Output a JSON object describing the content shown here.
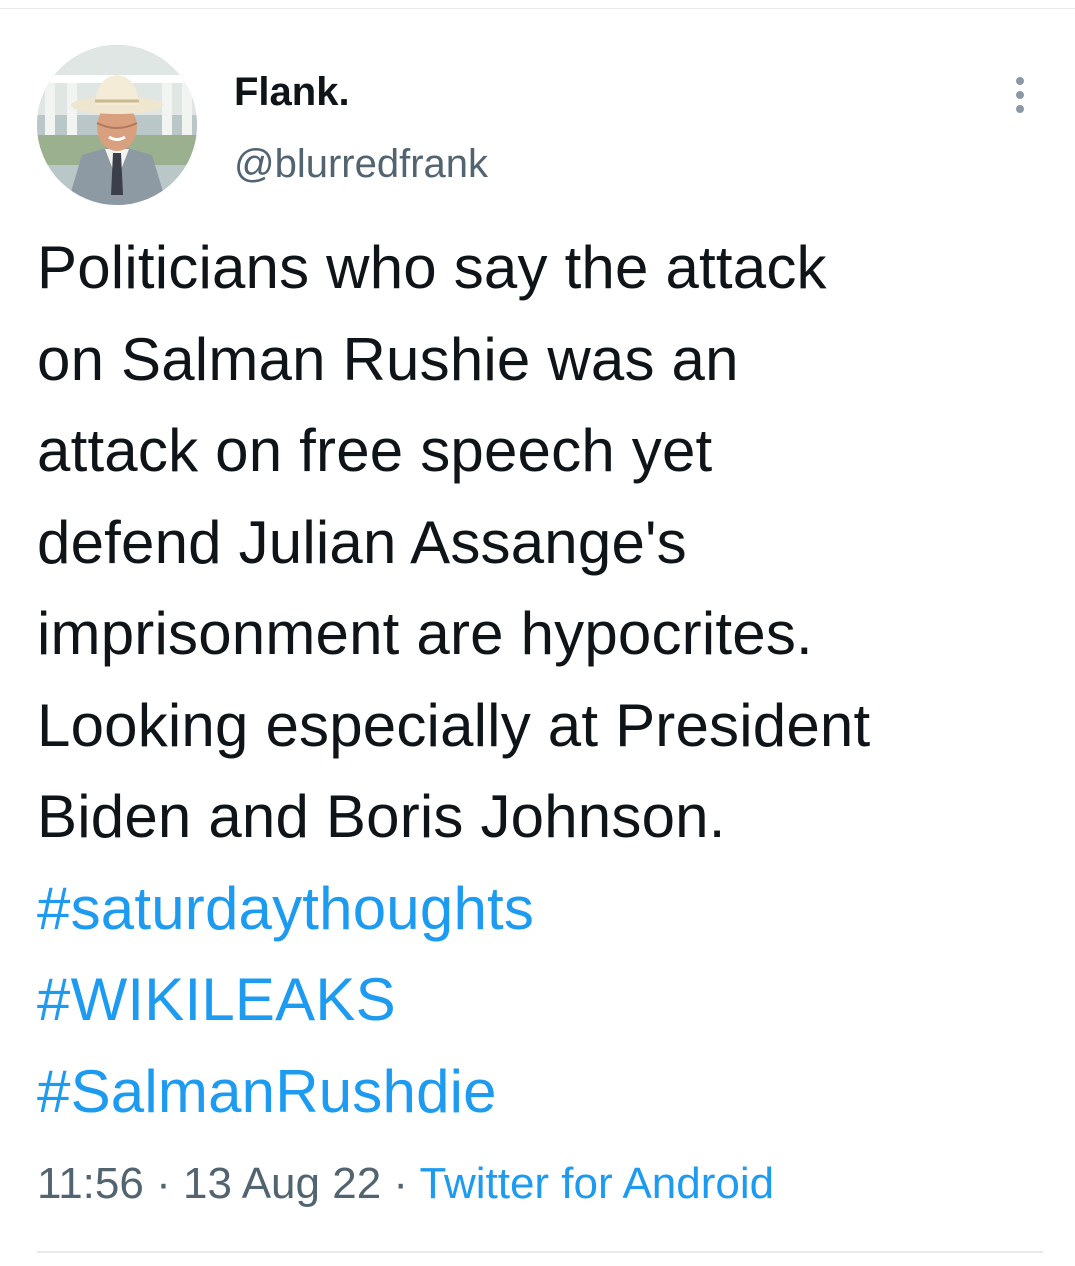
{
  "author": {
    "display_name": "Flank.",
    "handle": "@blurredfrank"
  },
  "tweet": {
    "text_lines": [
      "Politicians who say the attack",
      "on Salman Rushie was an",
      "attack on free speech yet",
      "defend Julian Assange's",
      "imprisonment are hypocrites.",
      "Looking especially at President",
      "Biden and Boris Johnson."
    ],
    "hashtags": [
      "#saturdaythoughts",
      "#WIKILEAKS",
      "#SalmanRushdie"
    ]
  },
  "meta": {
    "time": "11:56",
    "separator": "·",
    "date": "13 Aug 22",
    "source": "Twitter for Android"
  },
  "icons": {
    "more": "more-vertical-icon"
  },
  "colors": {
    "text": "#0f1419",
    "secondary": "#536471",
    "link": "#1d9bf0",
    "divider": "#e7e9ea"
  }
}
